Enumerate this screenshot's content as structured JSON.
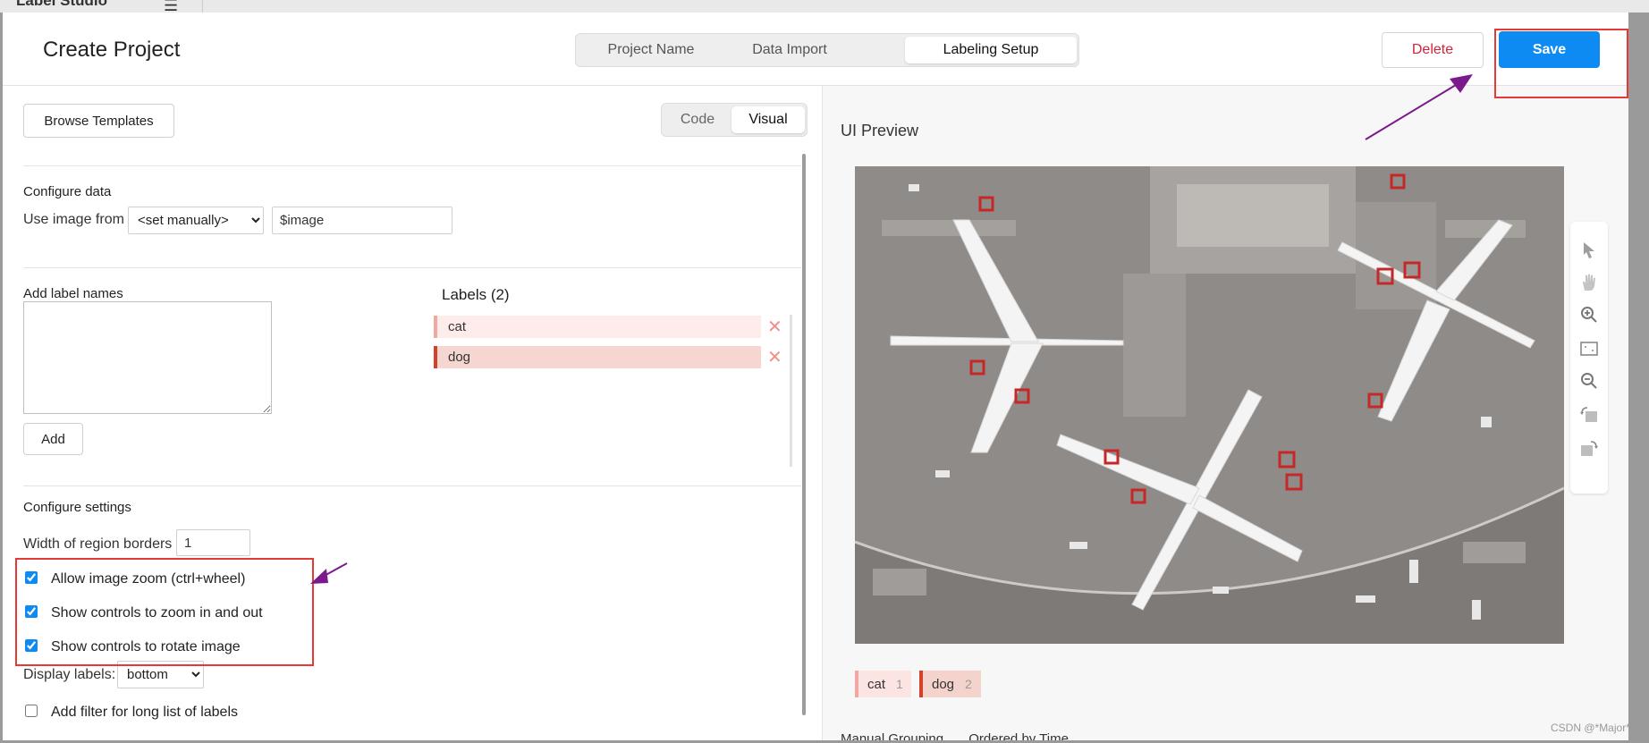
{
  "appbar": {
    "app_name": "Label Studio"
  },
  "header": {
    "title": "Create Project",
    "steps": [
      "Project Name",
      "Data Import",
      "Labeling Setup"
    ],
    "delete_label": "Delete",
    "save_label": "Save"
  },
  "left": {
    "browse_templates": "Browse Templates",
    "mode_tabs": [
      "Code",
      "Visual"
    ],
    "configure_data": {
      "title": "Configure data",
      "use_image_from": "Use image from",
      "source_value": "<set manually>",
      "field_value": "$image"
    },
    "add_label_names": {
      "title": "Add label names",
      "add_label": "Add"
    },
    "labels": {
      "heading": "Labels (2)",
      "items": [
        {
          "name": "cat",
          "color": "#f3a7a2"
        },
        {
          "name": "dog",
          "color": "#d4412b"
        }
      ],
      "remove_glyph": "✕"
    },
    "configure_settings": {
      "title": "Configure settings",
      "width_label": "Width of region borders",
      "width_value": "1",
      "options": [
        {
          "label": "Allow image zoom (ctrl+wheel)",
          "checked": true
        },
        {
          "label": "Show controls to zoom in and out",
          "checked": true
        },
        {
          "label": "Show controls to rotate image",
          "checked": true
        }
      ],
      "display_labels": "Display labels:",
      "display_value": "bottom",
      "filter_label": "Add filter for long list of labels",
      "filter_checked": false
    }
  },
  "right": {
    "title": "UI Preview",
    "pills": [
      {
        "name": "cat",
        "hotkey": "1"
      },
      {
        "name": "dog",
        "hotkey": "2"
      }
    ],
    "tools": [
      "pointer-icon",
      "hand-icon",
      "zoom-in-icon",
      "fit-icon",
      "zoom-out-icon",
      "rotate-left-icon",
      "rotate-right-icon"
    ],
    "bottom_bar": {
      "grouping": "Manual Grouping",
      "ordering": "Ordered by Time"
    }
  },
  "watermark": "CSDN @*Major*",
  "colors": {
    "accent": "#0d8bf2",
    "danger": "#d0243b",
    "annotation": "#e53935",
    "arrow": "#7a1a8c"
  }
}
